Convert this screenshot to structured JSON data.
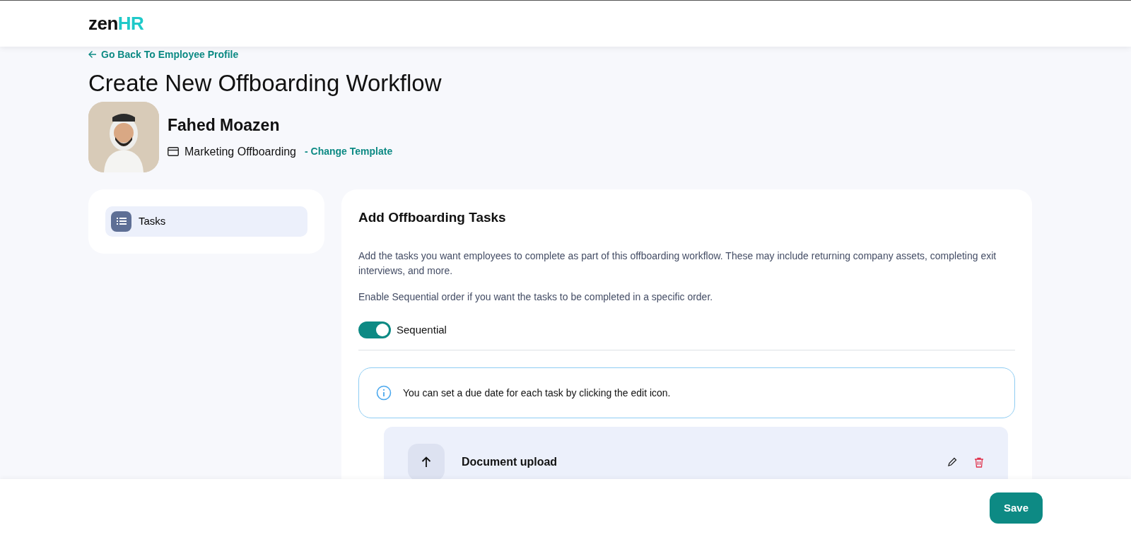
{
  "brand": {
    "part_1": "zen",
    "part_2": "HR"
  },
  "back_link": "Go Back To Employee Profile",
  "title": "Create New Offboarding Workflow",
  "employee": {
    "name": "Fahed Moazen",
    "template": "Marketing Offboarding",
    "change_link": "- Change Template"
  },
  "sidebar": {
    "items": [
      {
        "label": "Tasks",
        "selected": true
      }
    ]
  },
  "section": {
    "title": "Add Offboarding Tasks",
    "description": "Add the tasks you want employees to complete as part of this offboarding workflow. These may include returning company assets, completing exit interviews, and more.",
    "hint": "Enable Sequential order if you want the tasks to be completed in a specific order.",
    "toggle": {
      "label": "Sequential",
      "on": true
    },
    "info": "You can set a due date for each task by clicking the edit icon.",
    "tasks": [
      {
        "title": "Document upload"
      }
    ]
  },
  "footer": {
    "save": "Save"
  }
}
